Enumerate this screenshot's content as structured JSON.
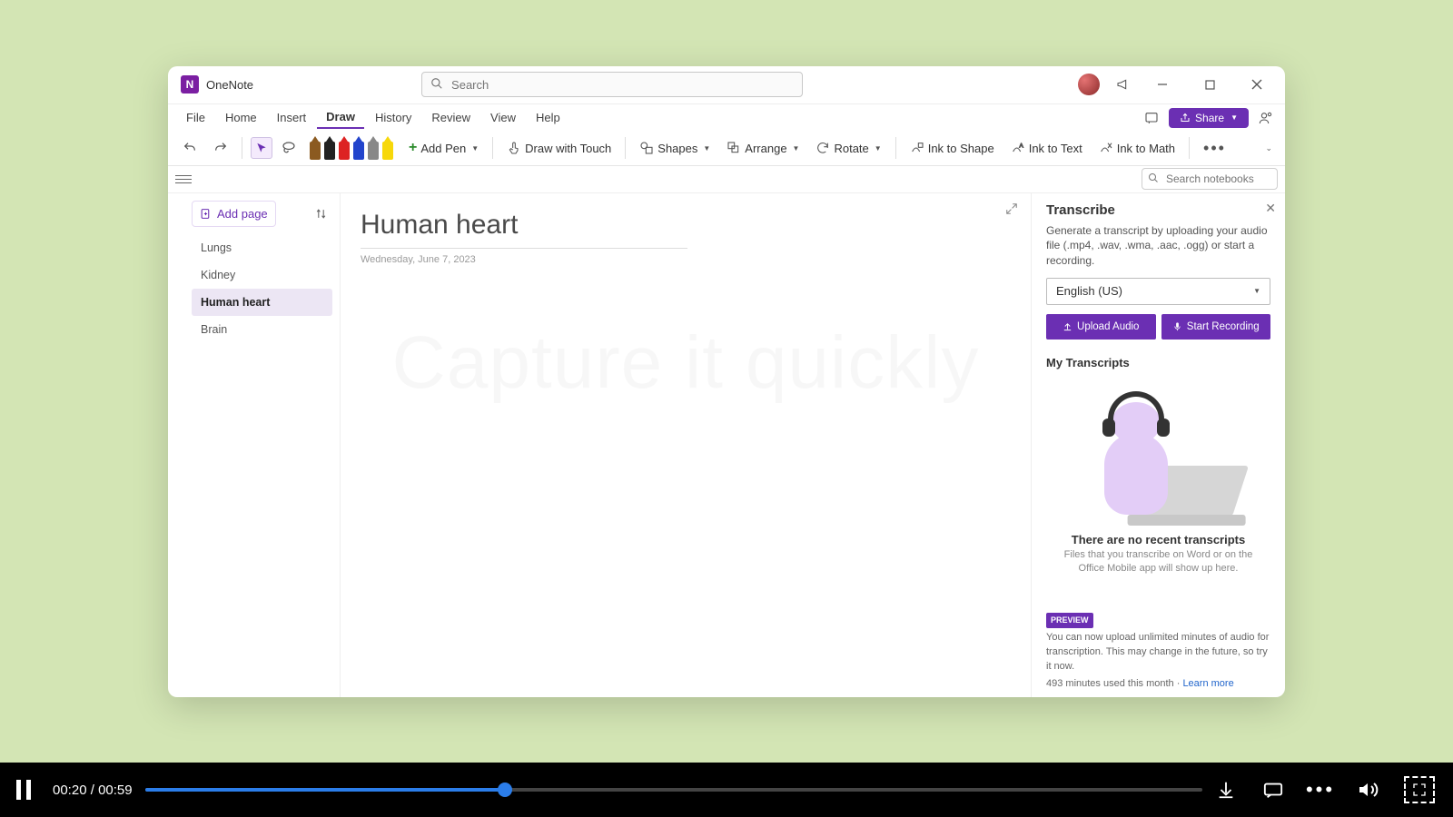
{
  "app": {
    "title": "OneNote"
  },
  "search": {
    "placeholder": "Search"
  },
  "menus": {
    "file": "File",
    "home": "Home",
    "insert": "Insert",
    "draw": "Draw",
    "history": "History",
    "review": "Review",
    "view": "View",
    "help": "Help",
    "share": "Share"
  },
  "ribbon": {
    "add_pen": "Add Pen",
    "draw_touch": "Draw with Touch",
    "shapes": "Shapes",
    "arrange": "Arrange",
    "rotate": "Rotate",
    "ink_shape": "Ink to Shape",
    "ink_text": "Ink to Text",
    "ink_math": "Ink to Math"
  },
  "notebook_search": {
    "placeholder": "Search notebooks"
  },
  "pages": {
    "add_page": "Add page",
    "items": [
      {
        "label": "Lungs"
      },
      {
        "label": "Kidney"
      },
      {
        "label": "Human heart"
      },
      {
        "label": "Brain"
      }
    ]
  },
  "page": {
    "title": "Human heart",
    "date": "Wednesday, June 7, 2023",
    "watermark": "Capture it quickly"
  },
  "transcribe": {
    "title": "Transcribe",
    "description": "Generate a transcript by uploading your audio file (.mp4, .wav, .wma, .aac, .ogg) or start a recording.",
    "language": "English (US)",
    "upload": "Upload Audio",
    "record": "Start Recording",
    "my_transcripts": "My Transcripts",
    "empty_title": "There are no recent transcripts",
    "empty_sub": "Files that you transcribe on Word or on the Office Mobile app will show up here.",
    "preview_badge": "PREVIEW",
    "preview_text": "You can now upload unlimited minutes of audio for transcription. This may change in the future, so try it now.",
    "minutes_used": "493 minutes used this month",
    "learn_more": "Learn more"
  },
  "video": {
    "current": "00:20",
    "divider": " / ",
    "total": "00:59",
    "progress_percent": 34
  }
}
